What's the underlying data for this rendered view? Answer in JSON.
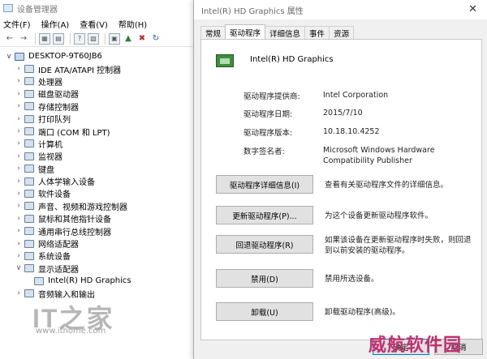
{
  "device_manager": {
    "title": "设备管理器",
    "menu": [
      "文件(F)",
      "操作(A)",
      "查看(V)",
      "帮助(H)"
    ],
    "toolbar_icons": [
      "back-icon",
      "forward-icon",
      "grid-icon",
      "window-icon",
      "help-icon",
      "properties-icon",
      "monitor-icon",
      "update-driver-icon",
      "uninstall-icon",
      "scan-icon"
    ],
    "tree": {
      "root": "DESKTOP-9T60JB6",
      "items": [
        {
          "label": "IDE ATA/ATAPI 控制器",
          "expanded": false
        },
        {
          "label": "处理器",
          "expanded": false
        },
        {
          "label": "磁盘驱动器",
          "expanded": false
        },
        {
          "label": "存储控制器",
          "expanded": false
        },
        {
          "label": "打印队列",
          "expanded": false
        },
        {
          "label": "端口 (COM 和 LPT)",
          "expanded": false
        },
        {
          "label": "计算机",
          "expanded": false
        },
        {
          "label": "监视器",
          "expanded": false
        },
        {
          "label": "键盘",
          "expanded": false
        },
        {
          "label": "人体学输入设备",
          "expanded": false
        },
        {
          "label": "软件设备",
          "expanded": false
        },
        {
          "label": "声音、视频和游戏控制器",
          "expanded": false
        },
        {
          "label": "鼠标和其他指针设备",
          "expanded": false
        },
        {
          "label": "通用串行总线控制器",
          "expanded": false
        },
        {
          "label": "网络适配器",
          "expanded": false
        },
        {
          "label": "系统设备",
          "expanded": false
        },
        {
          "label": "显示适配器",
          "expanded": true
        },
        {
          "label": "Intel(R) HD Graphics",
          "child": true
        },
        {
          "label": "音频输入和输出",
          "expanded": false
        }
      ]
    }
  },
  "properties": {
    "title": "Intel(R) HD Graphics 属性",
    "close": "✕",
    "tabs": [
      "常规",
      "驱动程序",
      "详细信息",
      "事件",
      "资源"
    ],
    "active_tab": "驱动程序",
    "device_name": "Intel(R) HD Graphics",
    "info": [
      {
        "label": "驱动程序提供商:",
        "value": "Intel Corporation"
      },
      {
        "label": "驱动程序日期:",
        "value": "2015/7/10"
      },
      {
        "label": "驱动程序版本:",
        "value": "10.18.10.4252"
      },
      {
        "label": "数字签名者:",
        "value": "Microsoft Windows Hardware Compatibility Publisher"
      }
    ],
    "buttons": [
      {
        "label": "驱动程序详细信息(I)",
        "description": "查看有关驱动程序文件的详细信息。"
      },
      {
        "label": "更新驱动程序(P)...",
        "description": "为这个设备更新驱动程序软件。"
      },
      {
        "label": "回退驱动程序(R)",
        "description": "如果该设备在更新驱动程序时失败，则回退到以前安装的驱动程序。"
      },
      {
        "label": "禁用(D)",
        "description": "禁用所选设备。"
      },
      {
        "label": "卸载(U)",
        "description": "卸载驱动程序(高级)。"
      }
    ],
    "ok": "确定",
    "cancel": "取消"
  },
  "watermarks": {
    "logo": "IT之家",
    "url": "www.ithome.com",
    "site": "威航软件园"
  }
}
